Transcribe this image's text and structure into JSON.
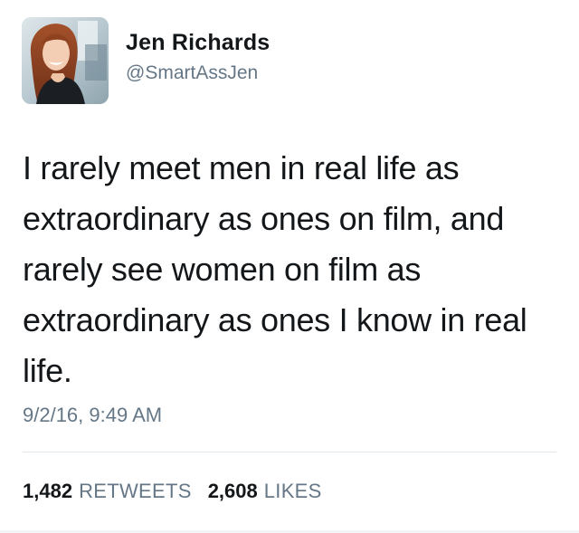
{
  "user": {
    "display_name": "Jen Richards",
    "handle": "@SmartAssJen",
    "avatar": "profile-photo"
  },
  "tweet": {
    "text": "I rarely meet men in real life as\nextraordinary as ones on film, and\nrarely see women on film as\nextraordinary as ones I know in real\nlife.",
    "timestamp": "9/2/16, 9:49 AM"
  },
  "stats": {
    "retweets_count": "1,482",
    "retweets_label": "RETWEETS",
    "likes_count": "2,608",
    "likes_label": "LIKES"
  },
  "colors": {
    "text": "#14171a",
    "secondary": "#657786",
    "divider": "#e1e8ed"
  }
}
